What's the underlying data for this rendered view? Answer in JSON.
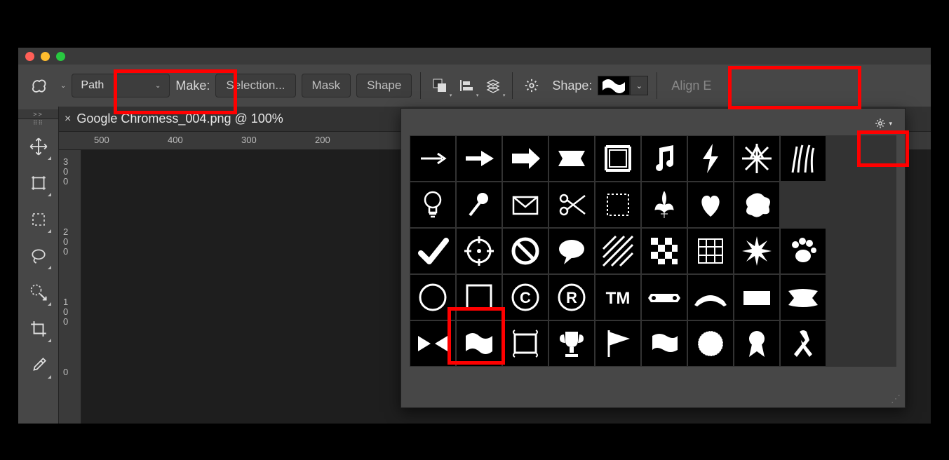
{
  "window": {
    "traffic": [
      "close",
      "minimize",
      "maximize"
    ]
  },
  "optionsBar": {
    "modeLabel": "Path",
    "makeLabel": "Make:",
    "selectionBtn": "Selection...",
    "maskBtn": "Mask",
    "shapeBtn": "Shape",
    "shapeLabel": "Shape:",
    "alignLabel": "Align E"
  },
  "document": {
    "tabTitle": "Google Chromess_004.png @ 100%",
    "rulerH": [
      "500",
      "400",
      "300",
      "200"
    ],
    "rulerV": [
      "3",
      "0",
      "0",
      "2",
      "0",
      "0",
      "1",
      "0",
      "0",
      "0"
    ]
  },
  "shapesPanel": {
    "selectedIndex": 37,
    "shapes": [
      "arrow-thin",
      "arrow-medium",
      "arrow-block",
      "banner-rect",
      "frame-stamp",
      "music-note",
      "lightning-bolt",
      "starburst",
      "grass",
      "light-bulb",
      "pushpin",
      "envelope",
      "scissors",
      "stamp-dotted",
      "fleur-de-lis",
      "heart",
      "blob",
      null,
      "checkmark",
      "crosshair",
      "no-sign",
      "speech-bubble",
      "diagonal-lines",
      "checkerboard",
      "grid",
      "spiky-burst",
      "paw-print",
      "circle-outline",
      "square-outline",
      "copyright",
      "registered",
      "trademark",
      "ribbon-banner",
      "ribbon-arc",
      "flag-simple",
      "flag-point",
      "bowtie",
      "flag-wave",
      "ornate-frame",
      "trophy",
      "pennant",
      "flag-wavy",
      "seal",
      "award-ribbon",
      "awareness-ribbon"
    ]
  },
  "tools": {
    "expandHandle": ">>",
    "list": [
      "move",
      "crop",
      "marquee",
      "lasso",
      "magic-wand",
      "perspective-crop",
      "eyedropper"
    ]
  }
}
